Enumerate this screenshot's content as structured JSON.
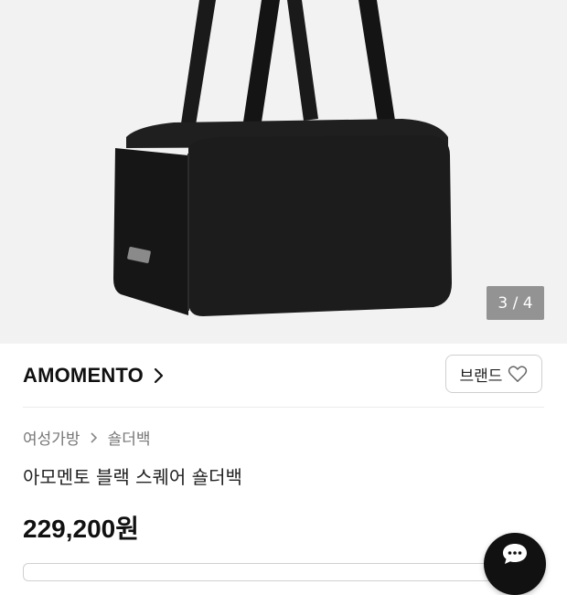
{
  "image": {
    "counter": "3 / 4",
    "alt_icon": "product-image"
  },
  "brand": {
    "name": "AMOMENTO",
    "button_label": "브랜드"
  },
  "breadcrumb": {
    "items": [
      "여성가방",
      "숄더백"
    ]
  },
  "product": {
    "title": "아모멘토 블랙 스퀘어 숄더백",
    "price": "229,200원"
  },
  "colors": {
    "accent": "#111111",
    "muted_text": "#777777",
    "image_bg": "#f2f2f2"
  },
  "icons": [
    "chevron-right-icon",
    "heart-icon",
    "chat-icon"
  ]
}
